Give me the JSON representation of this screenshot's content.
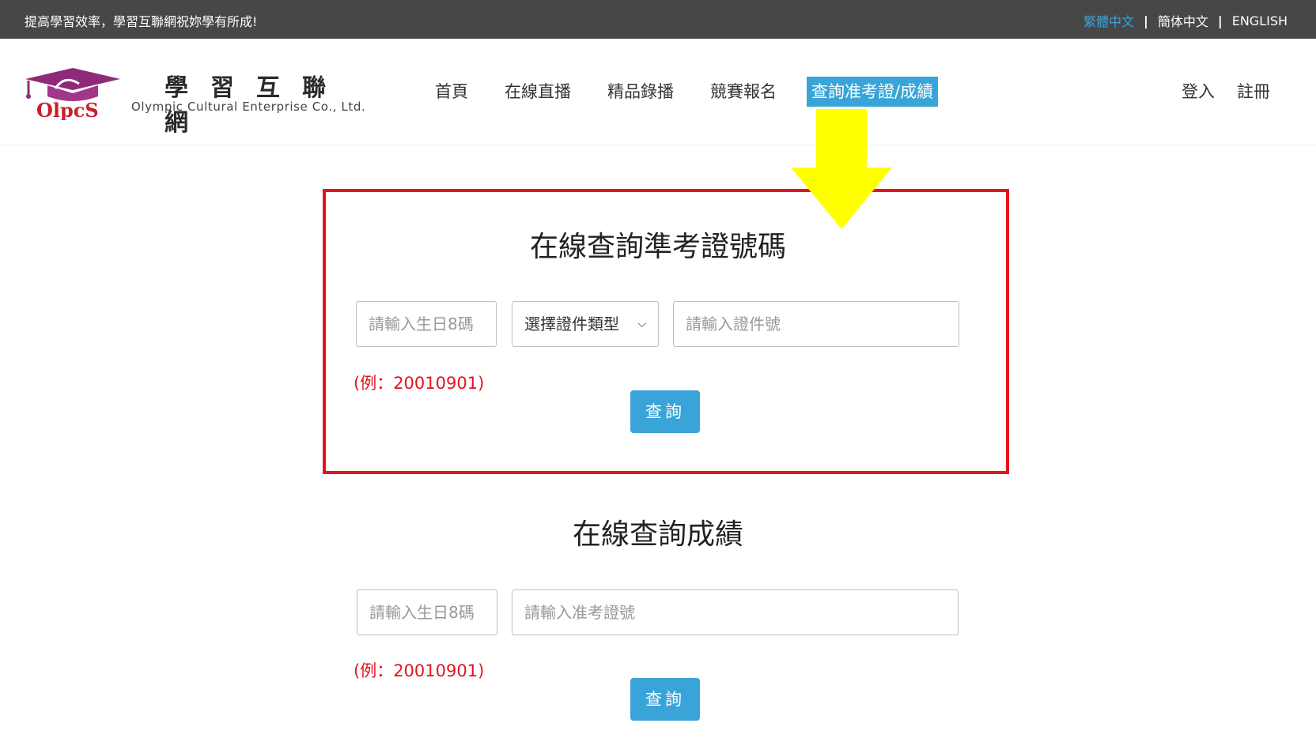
{
  "topbar": {
    "slogan": "提高學習效率，學習互聯網祝妳學有所成!",
    "languages": [
      {
        "label": "繁體中文",
        "active": true
      },
      {
        "label": "簡体中文",
        "active": false
      },
      {
        "label": "ENGLISH",
        "active": false
      }
    ],
    "separator": "|"
  },
  "brand": {
    "cn_name": "學習互聯網",
    "en_name": "Olympic Cultural Enterprise Co., Ltd.",
    "logo_text": "OlpcS"
  },
  "nav": [
    {
      "label": "首頁"
    },
    {
      "label": "在線直播"
    },
    {
      "label": "精品錄播"
    },
    {
      "label": "競賽報名"
    },
    {
      "label": "查詢准考證/成績",
      "active": true
    }
  ],
  "auth": {
    "login": "登入",
    "register": "註冊"
  },
  "admission_query": {
    "title": "在線查詢準考證號碼",
    "birthday_placeholder": "請輸入生日8碼",
    "id_type_selected": "選擇證件類型",
    "id_number_placeholder": "請輸入證件號",
    "example": "(例：20010901)",
    "submit_label": "查詢"
  },
  "score_query": {
    "title": "在線查詢成績",
    "birthday_placeholder": "請輸入生日8碼",
    "admission_placeholder": "請輸入准考證號",
    "example": "(例：20010901)",
    "submit_label": "查詢"
  },
  "colors": {
    "topbar_bg": "#474747",
    "accent": "#39a4d8",
    "highlight_border": "#e0161f",
    "arrow": "#ffff00",
    "logo_purple": "#8e2a79"
  }
}
